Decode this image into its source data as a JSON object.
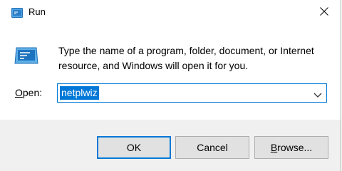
{
  "window": {
    "title": "Run",
    "icon": "run-icon",
    "close_icon": "close-icon"
  },
  "dialog": {
    "description": "Type the name of a program, folder, document, or Internet resource, and Windows will open it for you.",
    "icon": "run-program-icon"
  },
  "open_field": {
    "label_mnemonic": "O",
    "label_rest": "pen:",
    "value": "netplwiz",
    "dropdown_icon": "chevron-down-icon"
  },
  "buttons": {
    "ok": "OK",
    "cancel": "Cancel",
    "browse_mnemonic": "B",
    "browse_rest": "rowse..."
  },
  "colors": {
    "accent": "#0078d7",
    "footer_bg": "#f0f0f0",
    "button_bg": "#e1e1e1"
  }
}
